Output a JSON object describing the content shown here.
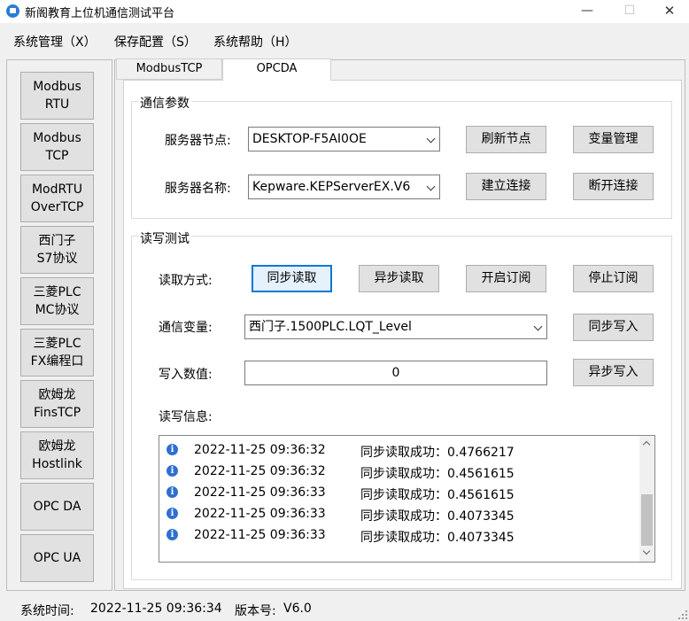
{
  "window": {
    "title": "新阁教育上位机通信测试平台",
    "minimize_glyph": "—",
    "maximize_glyph": "☐",
    "close_glyph": "✕"
  },
  "menu": [
    "系统管理（X）",
    "保存配置（S）",
    "系统帮助（H）"
  ],
  "sidebar": [
    "Modbus\nRTU",
    "Modbus\nTCP",
    "ModRTU\nOverTCP",
    "西门子\nS7协议",
    "三菱PLC\nMC协议",
    "三菱PLC\nFX编程口",
    "欧姆龙\nFinsTCP",
    "欧姆龙\nHostlink",
    "OPC DA",
    "OPC UA"
  ],
  "tabs": [
    "ModbusTCP",
    "OPCDA"
  ],
  "comm_params": {
    "title": "通信参数",
    "server_node_label": "服务器节点:",
    "server_node_value": "DESKTOP-F5AI0OE",
    "server_name_label": "服务器名称:",
    "server_name_value": "Kepware.KEPServerEX.V6",
    "refresh_btn": "刷新节点",
    "var_mgmt_btn": "变量管理",
    "connect_btn": "建立连接",
    "disconnect_btn": "断开连接"
  },
  "rw_test": {
    "title": "读写测试",
    "read_mode_label": "读取方式:",
    "sync_read_btn": "同步读取",
    "async_read_btn": "异步读取",
    "sub_start_btn": "开启订阅",
    "sub_stop_btn": "停止订阅",
    "comm_var_label": "通信变量:",
    "comm_var_value": "西门子.1500PLC.LQT_Level",
    "sync_write_btn": "同步写入",
    "write_value_label": "写入数值:",
    "write_value": "0",
    "async_write_btn": "异步写入",
    "info_label": "读写信息:"
  },
  "log": [
    {
      "time": "2022-11-25 09:36:32",
      "msg": "同步读取成功：0.4766217"
    },
    {
      "time": "2022-11-25 09:36:32",
      "msg": "同步读取成功：0.4561615"
    },
    {
      "time": "2022-11-25 09:36:33",
      "msg": "同步读取成功：0.4561615"
    },
    {
      "time": "2022-11-25 09:36:33",
      "msg": "同步读取成功：0.4073345"
    },
    {
      "time": "2022-11-25 09:36:33",
      "msg": "同步读取成功：0.4073345"
    }
  ],
  "status": {
    "time_label": "系统时间:",
    "time_value": "2022-11-25 09:36:34",
    "version_label": "版本号:",
    "version_value": "V6.0"
  },
  "colors": {
    "accent": "#0078d7",
    "info_icon": "#2f6fd0"
  },
  "icons": {
    "app": "app-logo-icon",
    "info": "info-icon",
    "combo": "chevron-down-icon"
  }
}
